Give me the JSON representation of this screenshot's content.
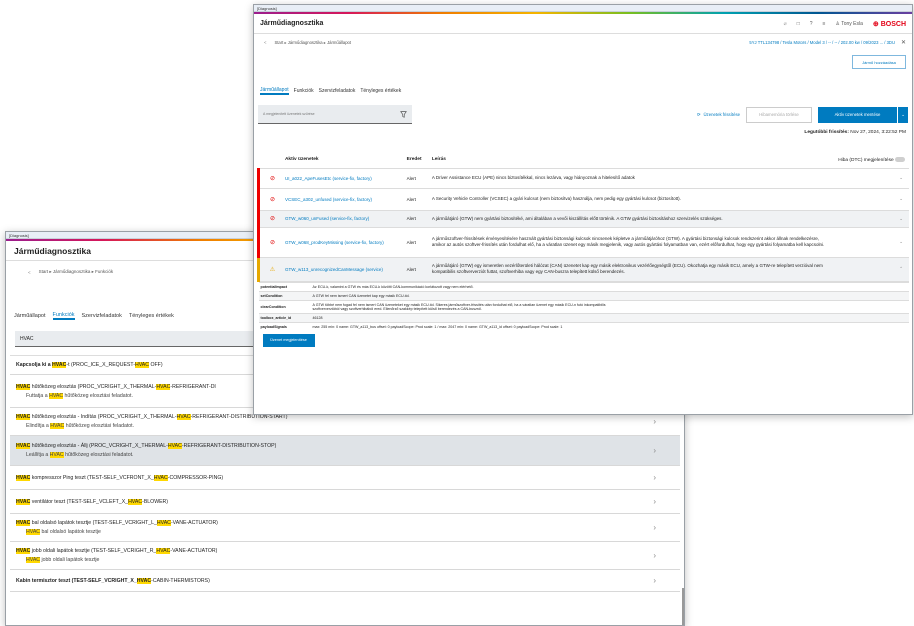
{
  "window1": {
    "titlebar": "[Diagnosis]",
    "app_title": "Járműdiagnosztika",
    "breadcrumb": "Start ▸ Járműdiagnosztika ▸ Funkciók",
    "tabs": [
      "Járműállapot",
      "Funkciók",
      "Szervizfeladatok",
      "Tényleges értékek"
    ],
    "active_tab": "Funkciók",
    "search_value": "HVAC",
    "items": [
      {
        "pre": "Kapcsolja ki a ",
        "hl": "HVAC",
        "post": "-t (PROC_ICE_X_REQUEST-",
        "hl2": "HVAC",
        "post2": " OFF)",
        "sub_pre": "",
        "sub_hl": "",
        "sub_post": ""
      },
      {
        "pre": "",
        "hl": "HVAC",
        "post": " hűtőközeg elosztás (PROC_VCRIGHT_X_THERMAL-",
        "hl2": "HVAC",
        "post2": "-REFRIGERANT-DI",
        "sub_pre": "Futtatja a ",
        "sub_hl": "HVAC",
        "sub_post": " hűtőközeg elosztási feladatot."
      },
      {
        "pre": "",
        "hl": "HVAC",
        "post": " hűtőközeg elosztás - Indítás (PROC_VCRIGHT_X_THERMAL-",
        "hl2": "HVAC",
        "post2": "-REFRIGERANT-DISTRIBUTION-START)",
        "sub_pre": "Elindítja a ",
        "sub_hl": "HVAC",
        "sub_post": " hűtőközeg elosztási feladatot."
      },
      {
        "pre": "",
        "hl": "HVAC",
        "post": " hűtőközeg elosztás - Állj (PROC_VCRIGHT_X_THERMAL-",
        "hl2": "HVAC",
        "post2": "-REFRIGERANT-DISTRIBUTION-STOP)",
        "sub_pre": "Leállítja a ",
        "sub_hl": "HVAC",
        "sub_post": " hűtőközeg elosztási feladatot."
      },
      {
        "pre": "",
        "hl": "HVAC",
        "post": " kompresszor Ping teszt (TEST-SELF_VCFRONT_X_",
        "hl2": "HVAC",
        "post2": "-COMPRESSOR-PING)",
        "sub_pre": "",
        "sub_hl": "",
        "sub_post": ""
      },
      {
        "pre": "",
        "hl": "HVAC",
        "post": " ventilátor teszt (TEST-SELF_VCLEFT_X_",
        "hl2": "HVAC",
        "post2": "-BLOWER)",
        "sub_pre": "",
        "sub_hl": "",
        "sub_post": ""
      },
      {
        "pre": "",
        "hl": "HVAC",
        "post": " bal oldalsó lapátok tesztje (TEST-SELF_VCRIGHT_L_",
        "hl2": "HVAC",
        "post2": "-VANE-ACTUATOR)",
        "sub_pre": "",
        "sub_hl": "HVAC",
        "sub_post": " bal oldalsó lapátok tesztje"
      },
      {
        "pre": "",
        "hl": "HVAC",
        "post": " jobb oldali lapátok tesztje (TEST-SELF_VCRIGHT_R_",
        "hl2": "HVAC",
        "post2": "-VANE-ACTUATOR)",
        "sub_pre": "",
        "sub_hl": "HVAC",
        "sub_post": " jobb oldali lapátok tesztje"
      },
      {
        "pre": "Kabin termisztor teszt (TEST-SELF_VCRIGHT_X_",
        "hl": "HVAC",
        "post": "-CABIN-THERMISTORS)",
        "hl2": "",
        "post2": "",
        "sub_pre": "",
        "sub_hl": "",
        "sub_post": ""
      }
    ]
  },
  "window2": {
    "titlebar": "[Diagnosis]",
    "app_title": "Járműdiagnosztika",
    "user": "Tony Esla",
    "brand": "BOSCH",
    "breadcrumb": "Start ▸ Járműdiagnosztika ▸ Járműállapot",
    "vehicle": "5YJ TTL134798 / Tesla Motors / Model 3 / -- / -- / 202.00 kw / 09/2023 ... / 3DU",
    "report_button": "Jármű hozzáadása",
    "tabs": [
      "Járműállapot",
      "Funkciók",
      "Szervizfeladatok",
      "Tényleges értékek"
    ],
    "active_tab": "Járműállapot",
    "search_placeholder": "A megjelenített üzenetek szűrése",
    "refresh_messages": "Üzenetek frissítése",
    "clear_memory": "Hibamemória törlése",
    "save_active": "Aktív üzenetek mentése",
    "last_refresh_label": "Legutóbbi frissítés:",
    "last_refresh_value": "Nov 27, 2024, 3:22:52 PM",
    "columns": {
      "name": "Aktív üzenetek",
      "origin": "Eredet",
      "desc": "Leírás",
      "dtc": "Hiba (DTC) megjelenítése"
    },
    "messages": [
      {
        "name": "UI_a022_ApeFusesEtc (service-fix, factory)",
        "origin": "Alert",
        "desc": "A Driver Assistance ECU (APE) nincs biztosítékkal, nincs lezárva, vagy hiányoznak a hitelesítő adatok",
        "level": "red"
      },
      {
        "name": "VCSEC_a302_unfused (service-fix, factory)",
        "origin": "Alert",
        "desc": "A Security Vehicle Controller (VCSEC) a gyári kulcsot (nem biztosítva) használja, nem pedig egy gyártási kulcsot (biztosított).",
        "level": "red"
      },
      {
        "name": "GTW_w060_unFused (service-fix, factory)",
        "origin": "Alert",
        "desc": "A járműátjáró (GTW) nem gyártási biztosítéké, ami általában a vevői kiszállítás előtt történik. A GTW gyártási biztosításhoz szervizelés szükséges.",
        "level": "red"
      },
      {
        "name": "GTW_w068_prodKeyMissing (service-fix, factory)",
        "origin": "Alert",
        "desc": "A járműszoftver-frissítések érvényesítésére használt gyártási biztonsági kulcsok nincsenek képletve a járműátjáróhoz (GTW). A gyártási biztonsági kulcsok rendszerint akkor állnak rendelkezésre, amikor az autós szoftver-frissítés után fordulhat elő, ha a váratlan üzenet egy másik megjelenik, vagy autós gyártási folyamatban van, ezért előfordulhat, hogy egy gyártási folyamatba kell kapcsolni.",
        "level": "red"
      },
      {
        "name": "GTW_w113_unrecognizedCanMessage (service)",
        "origin": "Alert",
        "desc": "A járműátjáró (GTW) egy ismeretlen vezérlőterületi hálózat (CAN) üzenetet kap egy másik elektronikus vezérlőegységtől (ECU). Okozhatja egy másik ECU, amely a GTW-re telepített verzióval nem kompatibilis szoftververziót futtat, szoftverhiba vagy egy CAN-buszra telepített külső berendezés.",
        "level": "amber"
      }
    ],
    "details": [
      {
        "key": "potentialImpact",
        "value": "Az ECU-k, valamint a GTW és más ECU-k közötti CAN-kommunikáció korlátozott vagy nem elérhető."
      },
      {
        "key": "setCondition",
        "value": "A GTW fel nem ismert CAN üzenetet kap egy másik ECU-tól."
      },
      {
        "key": "clearCondition",
        "value": "A GTW többé nem fogad fel nem ismert CAN üzeneteket egy másik ECU-tól. Sikeres járműszoftver-frissítés után fordulhat elő, ha a váratlan üzenet egy másik ECU-n futó inkompatibilis szoftververzióból vagy szoftverhibából ered. Ellenőrző szakkép telepített külső berendezés a CAN-buszról."
      },
      {
        "key": "toolbox_article_id",
        "value": "46128"
      },
      {
        "key": "payloadSignals",
        "value": "max: 255 min: 0 name: GTW_a113_bus offset: 0 payloadScope: Prod scale: 1 / max: 2047 min: 0 name: GTW_a113_id offset: 0 payloadScope: Prod scale: 1"
      }
    ],
    "show_message_button": "Üzenet megjelenítése"
  },
  "colors": {
    "accent": "#007bc0",
    "highlight": "#ffd800",
    "alert_red": "#e00000",
    "alert_amber": "#e6a800",
    "bosch_red": "#e20015"
  }
}
